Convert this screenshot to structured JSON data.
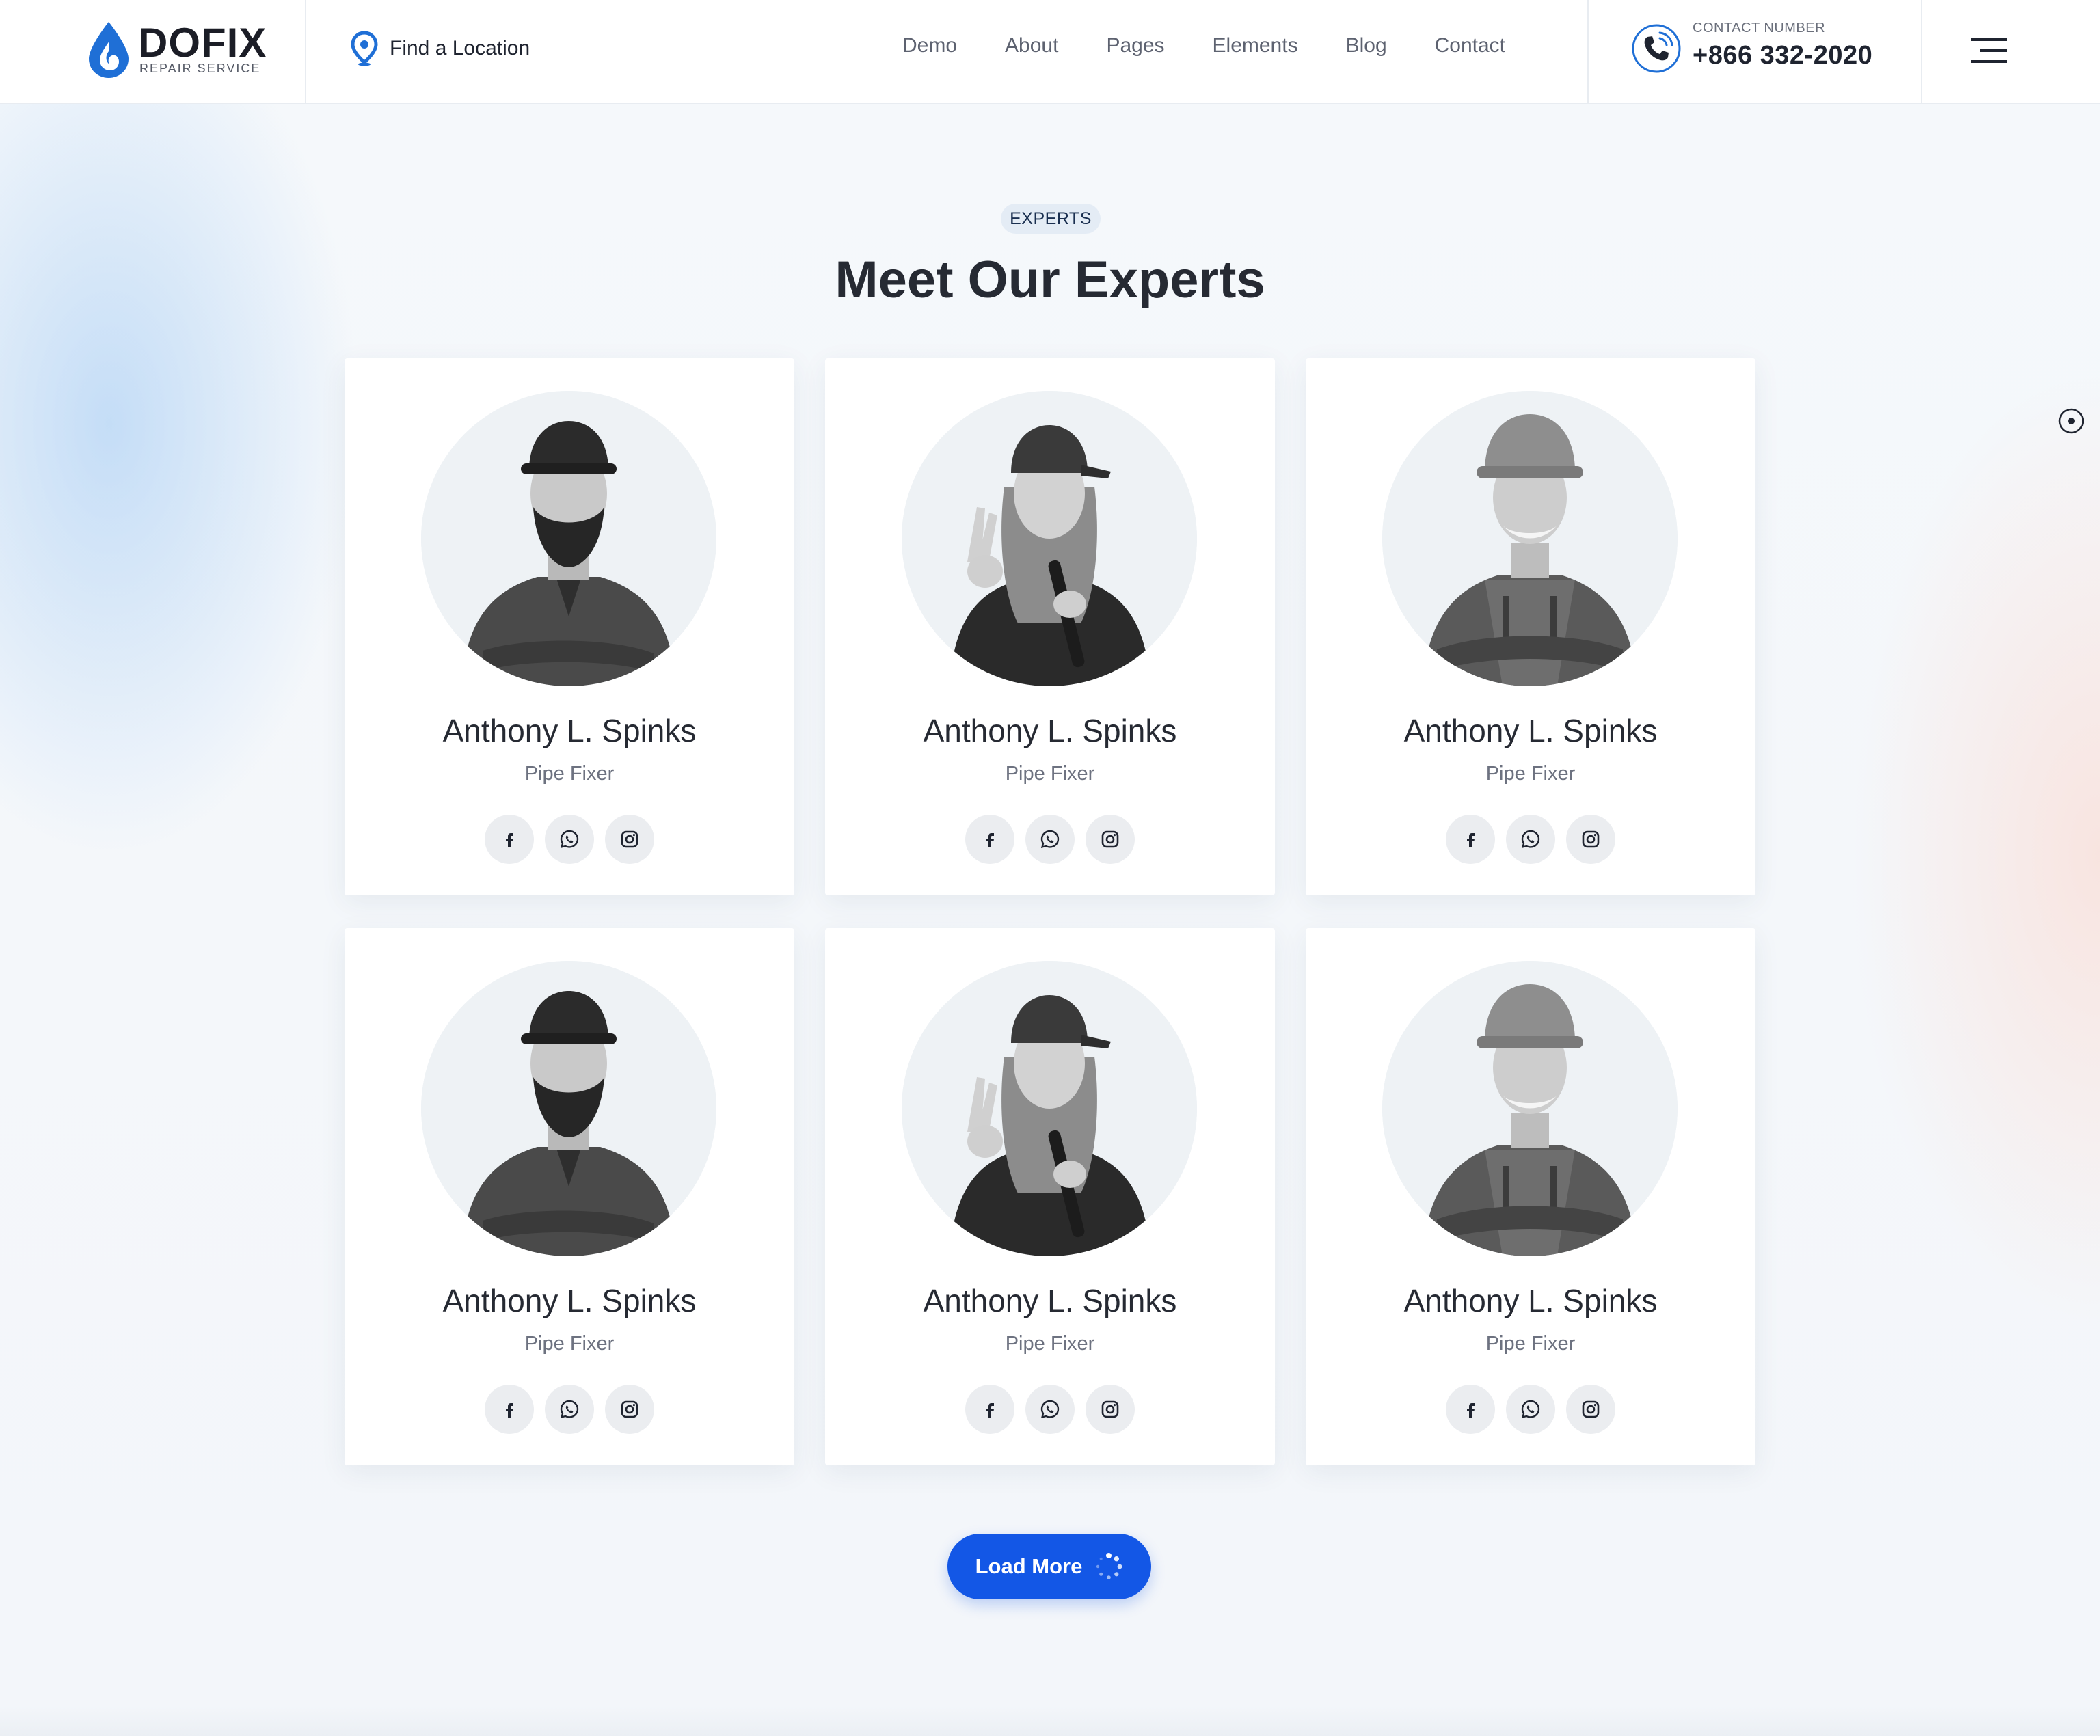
{
  "brand": {
    "name": "DOFIX",
    "tagline": "REPAIR SERVICE",
    "accent": "#1357e6"
  },
  "header": {
    "find_location": "Find a Location",
    "nav": [
      "Demo",
      "About",
      "Pages",
      "Elements",
      "Blog",
      "Contact"
    ],
    "contact_label": "CONTACT NUMBER",
    "contact_phone": "+866 332-2020"
  },
  "section": {
    "tag": "EXPERTS",
    "title": "Meet Our Experts"
  },
  "experts": [
    {
      "name": "Anthony L. Spinks",
      "role": "Pipe Fixer",
      "photo": "man-cap-beard"
    },
    {
      "name": "Anthony L. Spinks",
      "role": "Pipe Fixer",
      "photo": "woman-cap-wrench"
    },
    {
      "name": "Anthony L. Spinks",
      "role": "Pipe Fixer",
      "photo": "man-hardhat"
    },
    {
      "name": "Anthony L. Spinks",
      "role": "Pipe Fixer",
      "photo": "man-cap-beard"
    },
    {
      "name": "Anthony L. Spinks",
      "role": "Pipe Fixer",
      "photo": "woman-cap-wrench"
    },
    {
      "name": "Anthony L. Spinks",
      "role": "Pipe Fixer",
      "photo": "man-hardhat"
    }
  ],
  "social_icons": [
    "facebook-icon",
    "whatsapp-icon",
    "instagram-icon"
  ],
  "load_more": {
    "label": "Load More"
  }
}
